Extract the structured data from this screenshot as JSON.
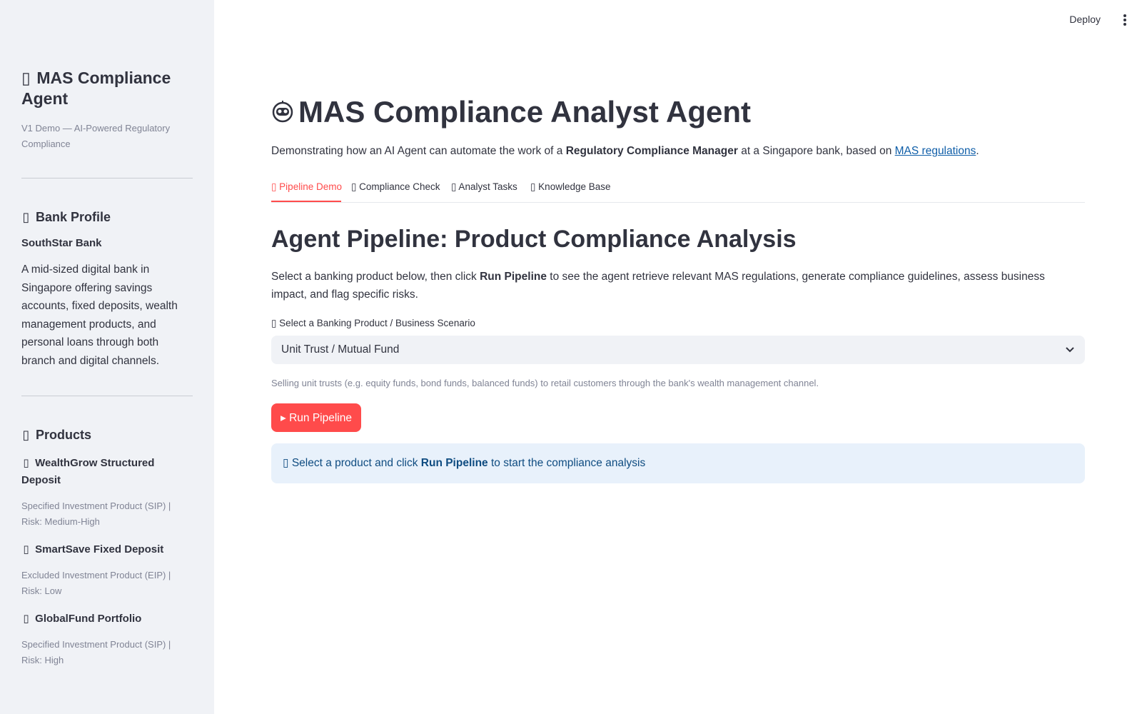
{
  "topbar": {
    "deploy_label": "Deploy",
    "menu_icon": "vertical-dots-icon"
  },
  "sidebar": {
    "title": "MAS Compliance Agent",
    "title_glyph": "▯",
    "caption": "V1 Demo — AI-Powered Regulatory Compliance",
    "bank_section": {
      "heading": "Bank Profile",
      "glyph": "▯",
      "bank_name": "SouthStar Bank",
      "description": "A mid-sized digital bank in Singapore offering savings accounts, fixed deposits, wealth management products, and personal loans through both branch and digital channels."
    },
    "products_section": {
      "heading": "Products",
      "glyph": "▯",
      "items": [
        {
          "glyph": "▯",
          "name": "WealthGrow Structured Deposit",
          "meta": "Specified Investment Product (SIP) | Risk: Medium-High"
        },
        {
          "glyph": "▯",
          "name": "SmartSave Fixed Deposit",
          "meta": "Excluded Investment Product (EIP) | Risk: Low"
        },
        {
          "glyph": "▯",
          "name": "GlobalFund Portfolio",
          "meta": "Specified Investment Product (SIP) | Risk: High"
        }
      ]
    }
  },
  "main": {
    "title": "MAS Compliance Analyst Agent",
    "title_icon": "robot-icon",
    "intro": {
      "prefix": "Demonstrating how an AI Agent can automate the work of a ",
      "role": "Regulatory Compliance Manager",
      "middle": " at a Singapore bank, based on ",
      "link": "MAS regulations",
      "suffix": "."
    },
    "tabs": [
      {
        "label": "▯ Pipeline Demo",
        "active": true
      },
      {
        "label": "▯ Compliance Check",
        "active": false
      },
      {
        "label": "▯ Analyst Tasks",
        "active": false
      },
      {
        "label": "▯ Knowledge Base",
        "active": false
      }
    ],
    "section_title": "Agent Pipeline: Product Compliance Analysis",
    "section_desc": {
      "prefix": "Select a banking product below, then click ",
      "bold": "Run Pipeline",
      "suffix": " to see the agent retrieve relevant MAS regulations, generate compliance guidelines, assess business impact, and flag specific risks."
    },
    "select": {
      "label": "▯ Select a Banking Product / Business Scenario",
      "value": "Unit Trust / Mutual Fund",
      "hint": "Selling unit trusts (e.g. equity funds, bond funds, balanced funds) to retail customers through the bank's wealth management channel."
    },
    "run_button": "▸ Run Pipeline",
    "info": {
      "glyph": "▯",
      "prefix": " Select a product and click ",
      "bold": "Run Pipeline",
      "suffix": " to start the compliance analysis"
    }
  },
  "colors": {
    "sidebar_bg": "#f0f2f6",
    "accent": "#ff4b4b",
    "info_bg": "#e8f1fb",
    "info_text": "#0f4c81",
    "link": "#0f5ea8"
  }
}
